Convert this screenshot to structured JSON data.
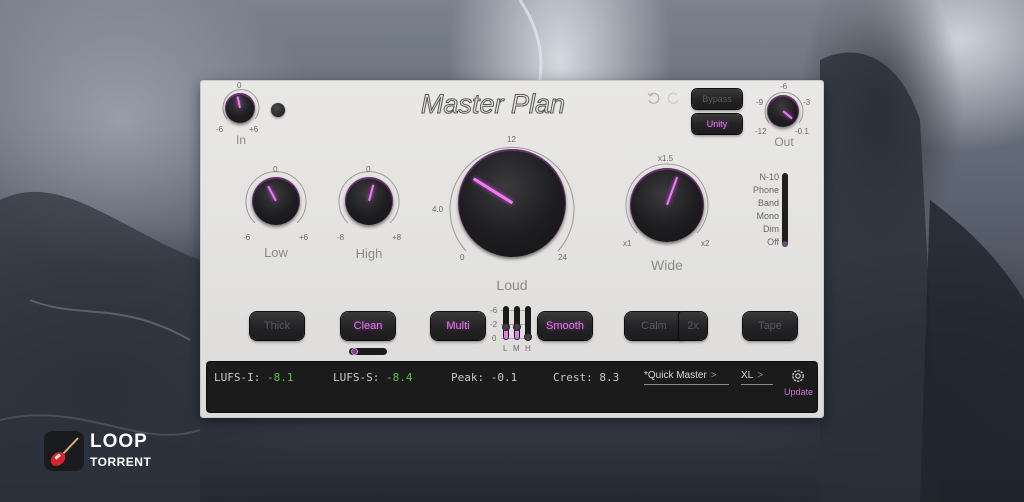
{
  "plugin": {
    "title": "Master Plan",
    "undo_icon": "undo-icon",
    "redo_icon": "redo-icon",
    "bypass_label": "Bypass",
    "unity_label": "Unity",
    "accent_color": "#e47fe8",
    "value_color": "#58c540"
  },
  "knobs": {
    "in": {
      "label": "In",
      "min": "-6",
      "mid": "0",
      "max": "+6",
      "value_fraction": 0.42
    },
    "out": {
      "label": "Out",
      "ticks": [
        "-12",
        "-9",
        "-6",
        "-3",
        "-0.1"
      ],
      "value_fraction": 0.9
    },
    "low": {
      "label": "Low",
      "min": "-6",
      "mid": "0",
      "max": "+6",
      "value_fraction": 0.38
    },
    "high": {
      "label": "High",
      "min": "-8",
      "mid": "0",
      "max": "+8",
      "value_fraction": 0.56
    },
    "loud": {
      "label": "Loud",
      "ticks": [
        "0",
        "4.0",
        "12",
        "24"
      ],
      "value_fraction": 0.22
    },
    "wide": {
      "label": "Wide",
      "min": "x1",
      "mid": "x1.5",
      "max": "x2",
      "value_fraction": 0.58
    }
  },
  "monitor_modes": {
    "options": [
      "N-10",
      "Phone",
      "Band",
      "Mono",
      "Dim",
      "Off"
    ],
    "selected": "Off"
  },
  "buttons": {
    "thick": {
      "label": "Thick",
      "on": false
    },
    "clean": {
      "label": "Clean",
      "on": true
    },
    "multi": {
      "label": "Multi",
      "on": true
    },
    "smooth": {
      "label": "Smooth",
      "on": true
    },
    "calm": {
      "label": "Calm",
      "on": false
    },
    "calm_2x": {
      "label": "2x",
      "on": false
    },
    "tape": {
      "label": "Tape",
      "on": false
    }
  },
  "clean_slider": {
    "value_fraction": 0.1
  },
  "band_meter": {
    "scale": [
      "-6",
      "-2",
      "0"
    ],
    "bands": [
      {
        "label": "L",
        "value_fraction": 0.45
      },
      {
        "label": "M",
        "value_fraction": 0.45
      },
      {
        "label": "H",
        "value_fraction": 0.0
      }
    ]
  },
  "readout": {
    "lufs_i_label": "LUFS-I:",
    "lufs_i_value": "-8.1",
    "lufs_s_label": "LUFS-S:",
    "lufs_s_value": "-8.4",
    "peak_label": "Peak:",
    "peak_value": "-0.1",
    "crest_label": "Crest:",
    "crest_value": "8.3",
    "preset_name": "*Quick Master",
    "preset_chevron": ">",
    "size_name": "XL",
    "size_chevron": ">",
    "settings_icon": "gear-icon",
    "update_label": "Update"
  },
  "watermark": {
    "line1": "LOOP",
    "line2": "TORRENT"
  }
}
